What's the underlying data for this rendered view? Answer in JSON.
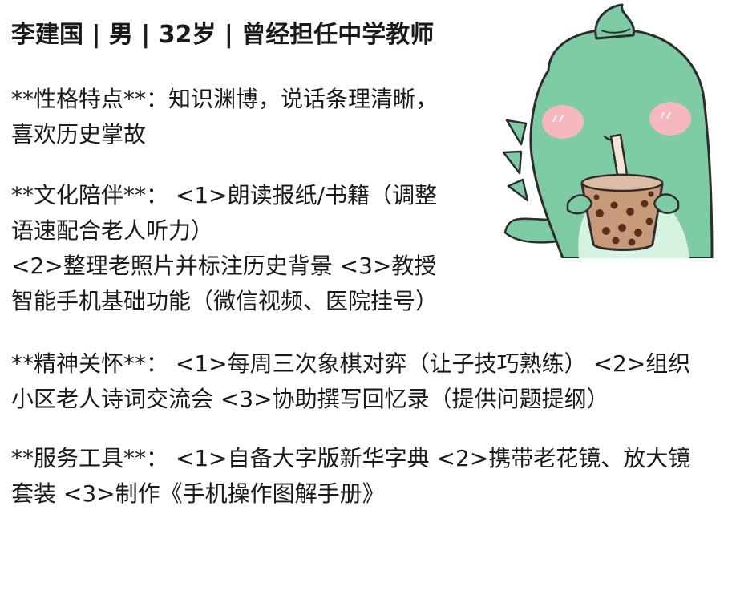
{
  "profile": {
    "title": "李建国 | 男 | 32岁 | 曾经担任中学教师"
  },
  "sections": [
    {
      "lines": [
        "**性格特点**：知识渊博，说话条理清晰，",
        "喜欢历史掌故"
      ]
    },
    {
      "lines": [
        "**文化陪伴**： <1>朗读报纸/书籍（调整",
        "语速配合老人听力）",
        "<2>整理老照片并标注历史背景 <3>教授",
        "智能手机基础功能（微信视频、医院挂号）"
      ]
    },
    {
      "lines": [
        "**精神关怀**： <1>每周三次象棋对弈（让子技巧熟练） <2>组织",
        "小区老人诗词交流会 <3>协助撰写回忆录（提供问题提纲）"
      ]
    },
    {
      "lines": [
        "**服务工具**： <1>自备大字版新华字典 <2>携带老花镜、放大镜",
        "套装 <3>制作《手机操作图解手册》"
      ]
    }
  ],
  "illustration": {
    "icon": "dinosaur-drinking-bubble-tea-icon",
    "colors": {
      "body": "#7ecba4",
      "outline": "#2d2d2d",
      "belly": "#d6f2e1",
      "cheek": "#f5b8c0",
      "cup": "#c79a7a",
      "pearls": "#5a2e1e",
      "straw": "#f4e6d6"
    }
  }
}
